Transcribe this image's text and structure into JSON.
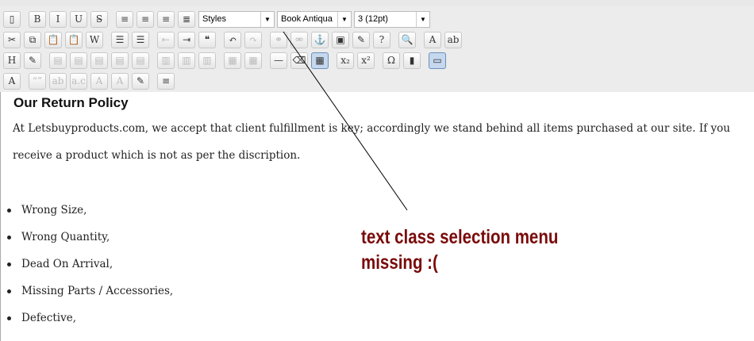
{
  "toolbar": {
    "row1": [
      {
        "icon": "new-document-icon",
        "g": "▯"
      },
      {
        "icon": "bold-icon",
        "g": "B"
      },
      {
        "icon": "italic-icon",
        "g": "I"
      },
      {
        "icon": "underline-icon",
        "g": "U"
      },
      {
        "icon": "strikethrough-icon",
        "g": "S̶"
      },
      {
        "icon": "align-left-icon",
        "g": "≡"
      },
      {
        "icon": "align-center-icon",
        "g": "≡"
      },
      {
        "icon": "align-right-icon",
        "g": "≡"
      },
      {
        "icon": "justify-icon",
        "g": "≣"
      }
    ],
    "styles_value": "Styles",
    "font_value": "Book Antiqua",
    "size_value": "3 (12pt)",
    "row2": [
      {
        "icon": "cut-icon",
        "g": "✂"
      },
      {
        "icon": "copy-icon",
        "g": "⧉"
      },
      {
        "icon": "paste-icon",
        "g": "📋"
      },
      {
        "icon": "paste-text-icon",
        "g": "📋"
      },
      {
        "icon": "paste-word-icon",
        "g": "W"
      },
      {
        "icon": "bullet-list-icon",
        "g": "☰"
      },
      {
        "icon": "numbered-list-icon",
        "g": "☰"
      },
      {
        "icon": "outdent-icon",
        "g": "⇤",
        "d": true
      },
      {
        "icon": "indent-icon",
        "g": "⇥"
      },
      {
        "icon": "blockquote-icon",
        "g": "❝"
      },
      {
        "icon": "undo-icon",
        "g": "↶"
      },
      {
        "icon": "redo-icon",
        "g": "↷",
        "d": true
      },
      {
        "icon": "link-icon",
        "g": "⚭",
        "d": true
      },
      {
        "icon": "unlink-icon",
        "g": "⚮",
        "d": true
      },
      {
        "icon": "anchor-icon",
        "g": "⚓"
      },
      {
        "icon": "image-icon",
        "g": "▣"
      },
      {
        "icon": "cleanup-icon",
        "g": "✎"
      },
      {
        "icon": "help-icon",
        "g": "?"
      },
      {
        "icon": "preview-icon",
        "g": "🔍"
      },
      {
        "icon": "text-color-icon",
        "g": "A"
      },
      {
        "icon": "highlight-color-icon",
        "g": "ab"
      }
    ],
    "row3": [
      {
        "icon": "html-source-icon",
        "g": "H"
      },
      {
        "icon": "edit-icon",
        "g": "✎"
      },
      {
        "icon": "table-row-props-icon",
        "g": "▤",
        "d": true
      },
      {
        "icon": "table-cell-props-icon",
        "g": "▤",
        "d": true
      },
      {
        "icon": "row-before-icon",
        "g": "▤",
        "d": true
      },
      {
        "icon": "row-after-icon",
        "g": "▤",
        "d": true
      },
      {
        "icon": "delete-row-icon",
        "g": "▤",
        "d": true
      },
      {
        "icon": "col-before-icon",
        "g": "▥",
        "d": true
      },
      {
        "icon": "col-after-icon",
        "g": "▥",
        "d": true
      },
      {
        "icon": "delete-col-icon",
        "g": "▥",
        "d": true
      },
      {
        "icon": "split-cells-icon",
        "g": "▦",
        "d": true
      },
      {
        "icon": "merge-cells-icon",
        "g": "▦",
        "d": true
      },
      {
        "icon": "horizontal-rule-icon",
        "g": "—"
      },
      {
        "icon": "eraser-icon",
        "g": "⌫"
      },
      {
        "icon": "table-icon",
        "g": "▦",
        "a": true
      },
      {
        "icon": "subscript-icon",
        "g": "x₂"
      },
      {
        "icon": "superscript-icon",
        "g": "x²"
      },
      {
        "icon": "special-char-icon",
        "g": "Ω"
      },
      {
        "icon": "media-icon",
        "g": "▮"
      },
      {
        "icon": "visual-aid-icon",
        "g": "▭",
        "a": true
      }
    ],
    "row4": [
      {
        "icon": "styleprops-icon",
        "g": "A"
      },
      {
        "icon": "cite-icon",
        "g": "“”",
        "d": true
      },
      {
        "icon": "abbr-icon",
        "g": "ab",
        "d": true
      },
      {
        "icon": "acronym-icon",
        "g": "a.c",
        "d": true
      },
      {
        "icon": "del-icon",
        "g": "A",
        "d": true
      },
      {
        "icon": "ins-icon",
        "g": "A",
        "d": true
      },
      {
        "icon": "attribs-icon",
        "g": "✎"
      },
      {
        "icon": "nonbreaking-icon",
        "g": "≡"
      }
    ]
  },
  "content": {
    "heading": "Our Return Policy",
    "para1": "At Letsbuyproducts.com, we accept that client fulfillment is key; accordingly we stand behind all items purchased at our site. If you",
    "para2": "receive a product which is not as per the discription.",
    "list": [
      "Wrong Size,",
      "Wrong Quantity,",
      "Dead On Arrival,",
      "Missing Parts / Accessories,",
      "Defective,"
    ]
  },
  "annotation": {
    "line1": "text class selection menu",
    "line2": "missing :(",
    "color": "#7a0a0a"
  }
}
